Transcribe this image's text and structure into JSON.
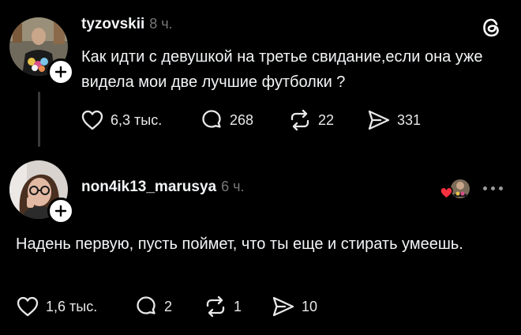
{
  "post": {
    "username": "tyzovskii",
    "time": "8 ч.",
    "text": "Как идти с девушкой на третье свидание,если она уже видела мои две лучшие футболки ?",
    "actions": {
      "likes": "6,3 тыс.",
      "comments": "268",
      "reposts": "22",
      "shares": "331"
    }
  },
  "reply": {
    "username": "non4ik13_marusya",
    "time": "6 ч.",
    "text": "Надень первую, пусть поймет, что ты еще и стирать умеешь.",
    "actions": {
      "likes": "1,6 тыс.",
      "comments": "2",
      "reposts": "1",
      "shares": "10"
    }
  },
  "icons": {
    "app_logo": "threads-logo-icon",
    "like": "heart-icon",
    "comment": "comment-bubble-icon",
    "repost": "repost-icon",
    "share": "send-icon",
    "more": "more-dots-icon",
    "follow": "plus-icon"
  },
  "colors": {
    "background": "#000000",
    "text": "#f3f5f7",
    "muted": "#777777",
    "liked_heart": "#ff3040"
  }
}
